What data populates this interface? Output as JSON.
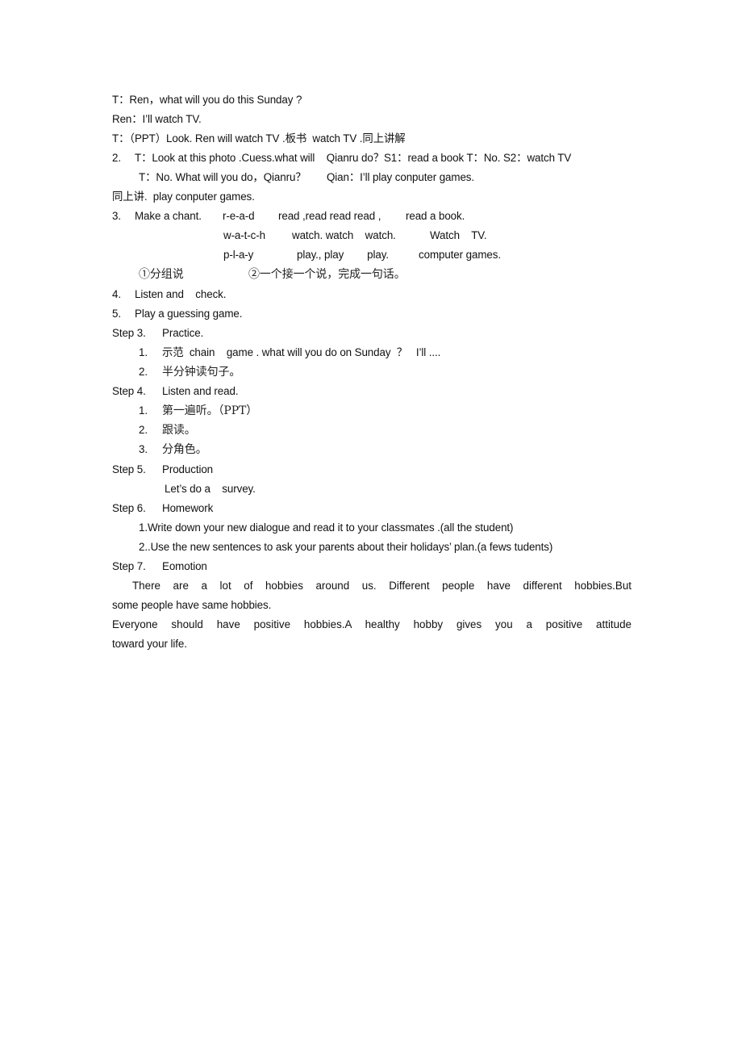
{
  "document": {
    "dialogue": [
      "T：Ren，what will you do this Sunday ?",
      "Ren：I’ll watch TV.",
      "T：（PPT）Look. Ren will watch TV .板书  watch TV .同上讲解"
    ],
    "item2": {
      "num": "2.",
      "line1": "T：Look at this photo .Cuess.what will    Qianru do？S1：read a book T：No. S2：watch TV",
      "line2": "T：No. What will you do，Qianru？       Qian：I’ll play conputer games.",
      "line3": "同上讲.  play conputer games."
    },
    "item3": {
      "num": "3.",
      "label": "Make a chant.",
      "chant": [
        {
          "spell": "r-e-a-d",
          "words": "read ,read read read ,",
          "phrase": "read a book."
        },
        {
          "spell": "w-a-t-c-h",
          "words": "watch. watch    watch.",
          "phrase": "Watch    TV."
        },
        {
          "spell": "p-l-a-y",
          "words": "play., play        play.",
          "phrase": "computer games."
        }
      ],
      "methods": [
        "①分组说",
        "②一个接一个说，完成一句话。"
      ]
    },
    "item4": {
      "num": "4.",
      "text": "Listen and    check."
    },
    "item5": {
      "num": "5.",
      "text": "Play a guessing game."
    },
    "steps": [
      {
        "label": "Step 3.",
        "title": "Practice.",
        "items": [
          {
            "num": "1.",
            "text": "示范  chain    game . what will you do on Sunday  ？   I’ll ...."
          },
          {
            "num": "2.",
            "text": "半分钟读句子。"
          }
        ]
      },
      {
        "label": "Step 4.",
        "title": "Listen and read.",
        "items": [
          {
            "num": "1.",
            "text": "第一遍听。（PPT）"
          },
          {
            "num": "2.",
            "text": "跟读。"
          },
          {
            "num": "3.",
            "text": "分角色。"
          }
        ]
      },
      {
        "label": "Step 5.",
        "title": "Production",
        "sub": "Let’s do a    survey."
      },
      {
        "label": "Step 6.",
        "title": "Homework",
        "lines": [
          "1.Write down your new dialogue and read it to your classmates .(all the student)",
          "2..Use the new sentences to ask your parents about their holidays’ plan.(a fews tudents)"
        ]
      },
      {
        "label": "Step 7.",
        "title": "Eomotion"
      }
    ],
    "emotion": {
      "p1_line1": "There are a lot of hobbies    around    us.    Different    people    have different hobbies.But",
      "p1_line2": "some people have same hobbies.",
      "p2_line1": "Everyone    should    have positive hobbies.A healthy hobby    gives you a positive attitude",
      "p2_line2": "toward your life."
    }
  }
}
